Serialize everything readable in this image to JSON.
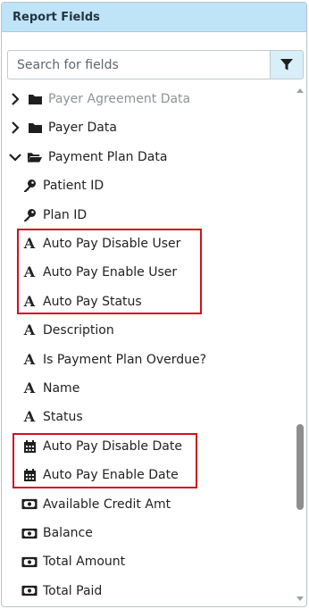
{
  "panel": {
    "title": "Report Fields"
  },
  "search": {
    "placeholder": "Search for fields",
    "filter_icon": "filter-icon"
  },
  "tree": {
    "items": [
      {
        "label": "Payer Agreement Data",
        "type": "folder",
        "expanded": false,
        "muted": true
      },
      {
        "label": "Payer Data",
        "type": "folder",
        "expanded": false
      },
      {
        "label": "Payment Plan Data",
        "type": "folder",
        "expanded": true
      },
      {
        "label": "Patient ID",
        "type": "key"
      },
      {
        "label": "Plan ID",
        "type": "key"
      },
      {
        "label": "Auto Pay Disable User",
        "type": "text"
      },
      {
        "label": "Auto Pay Enable User",
        "type": "text"
      },
      {
        "label": "Auto Pay Status",
        "type": "text"
      },
      {
        "label": "Description",
        "type": "text"
      },
      {
        "label": "Is Payment Plan Overdue?",
        "type": "text"
      },
      {
        "label": "Name",
        "type": "text"
      },
      {
        "label": "Status",
        "type": "text"
      },
      {
        "label": "Auto Pay Disable Date",
        "type": "date"
      },
      {
        "label": "Auto Pay Enable Date",
        "type": "date"
      },
      {
        "label": "Available Credit Amt",
        "type": "money"
      },
      {
        "label": "Balance",
        "type": "money"
      },
      {
        "label": "Total Amount",
        "type": "money"
      },
      {
        "label": "Total Paid",
        "type": "money"
      }
    ]
  },
  "highlight_color": "#d0101a",
  "accent_color": "#bfe3f7"
}
